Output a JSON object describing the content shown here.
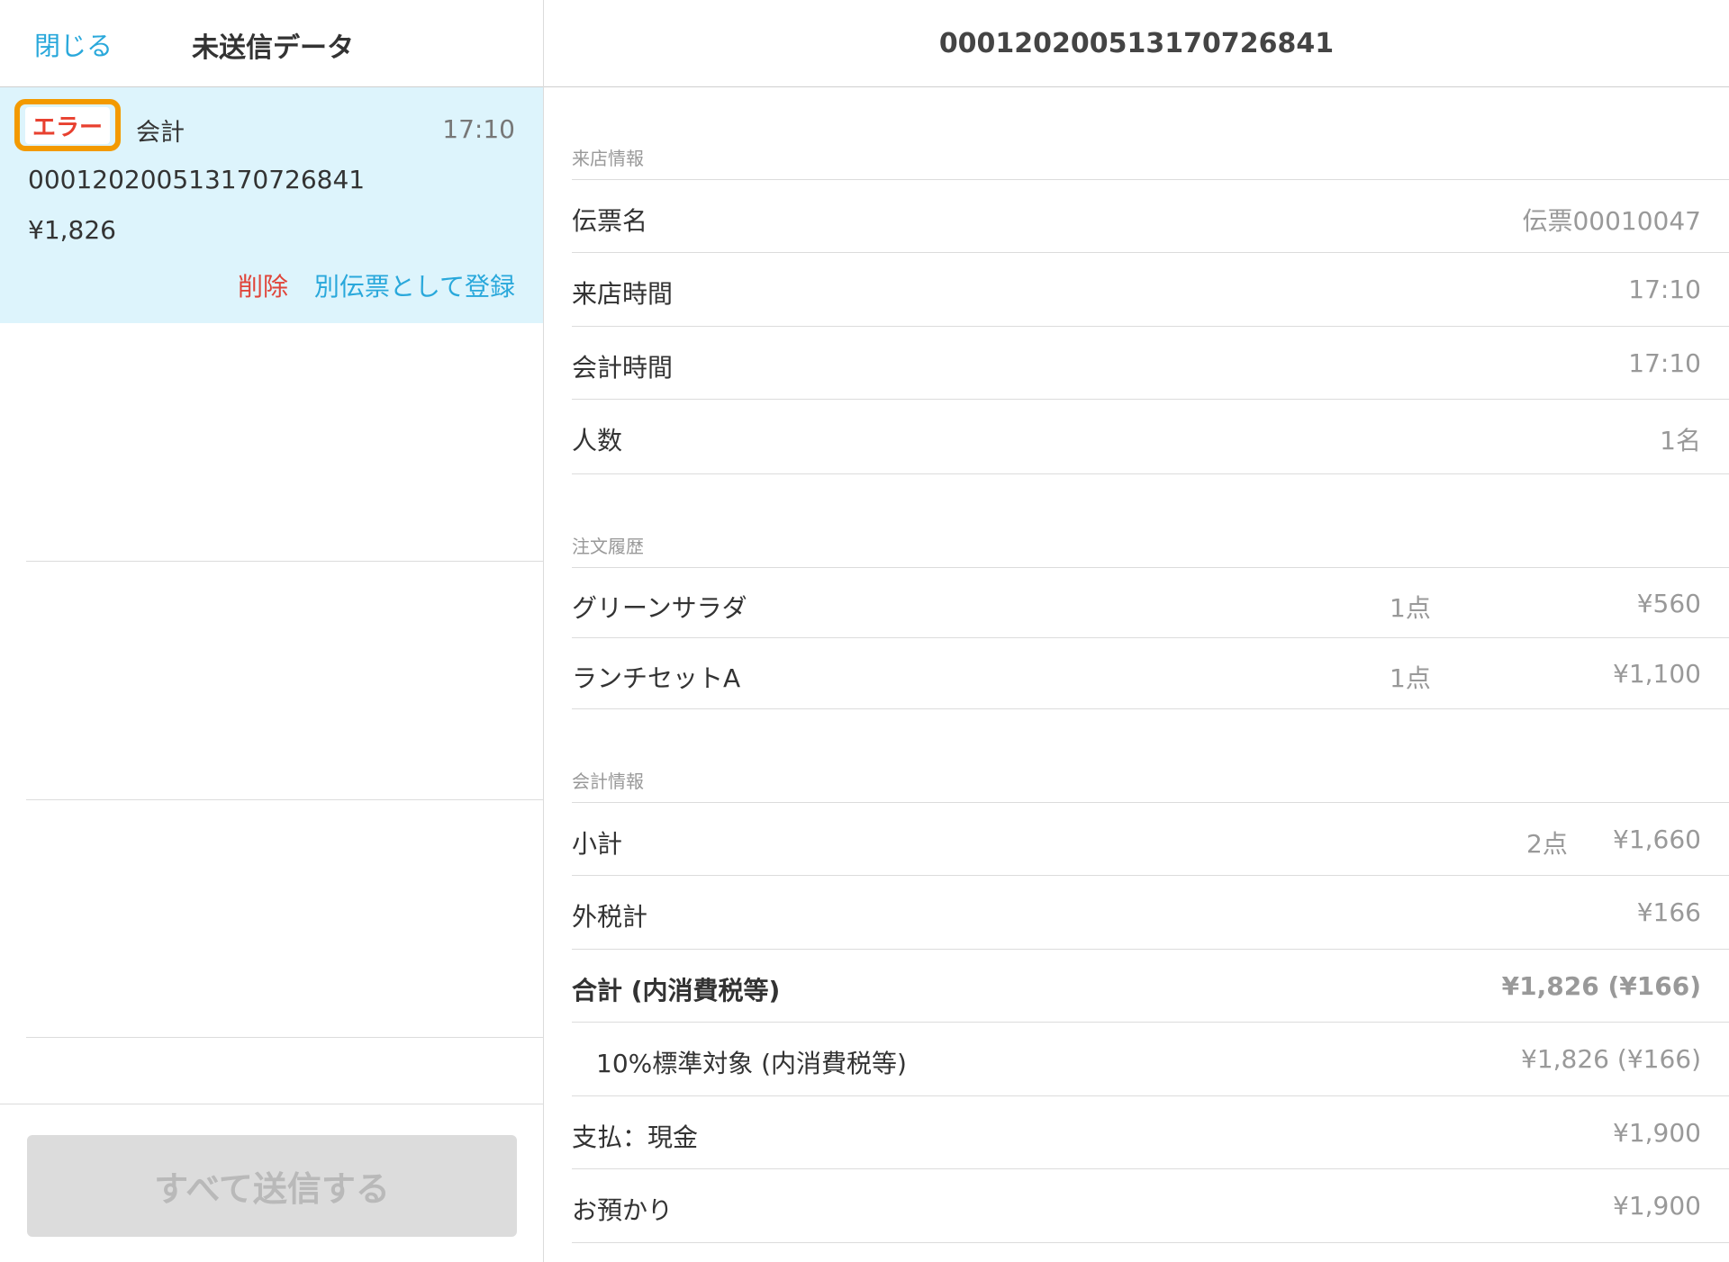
{
  "left": {
    "close_label": "閉じる",
    "title": "未送信データ",
    "record": {
      "badge": "エラー",
      "type": "会計",
      "time": "17:10",
      "id": "00012020051317072684​1",
      "amount": "¥1,826",
      "delete_label": "削除",
      "register_label": "別伝票として登録"
    },
    "send_all_label": "すべて送信する"
  },
  "right": {
    "title": "00012020051317072684​1",
    "visit_section": {
      "label": "来店情報",
      "rows": [
        {
          "label": "伝票名",
          "value": "伝票00010047"
        },
        {
          "label": "来店時間",
          "value": "17:10"
        },
        {
          "label": "会計時間",
          "value": "17:10"
        },
        {
          "label": "人数",
          "value": "1名"
        }
      ]
    },
    "order_section": {
      "label": "注文履歴",
      "rows": [
        {
          "label": "グリーンサラダ",
          "qty": "1点",
          "value": "¥560"
        },
        {
          "label": "ランチセットA",
          "qty": "1点",
          "value": "¥1,100"
        }
      ]
    },
    "payment_section": {
      "label": "会計情報",
      "rows": [
        {
          "label": "小計",
          "qty": "2点",
          "value": "¥1,660"
        },
        {
          "label": "外税計",
          "value": "¥166"
        },
        {
          "label": "合計 (内消費税等)",
          "value": "¥1,826 (¥166)"
        },
        {
          "label": "10%標準対象 (内消費税等)",
          "value": "¥1,826 (¥166)"
        },
        {
          "label": "支払：現金",
          "value": "¥1,900"
        },
        {
          "label": "お預かり",
          "value": "¥1,900"
        }
      ]
    }
  }
}
